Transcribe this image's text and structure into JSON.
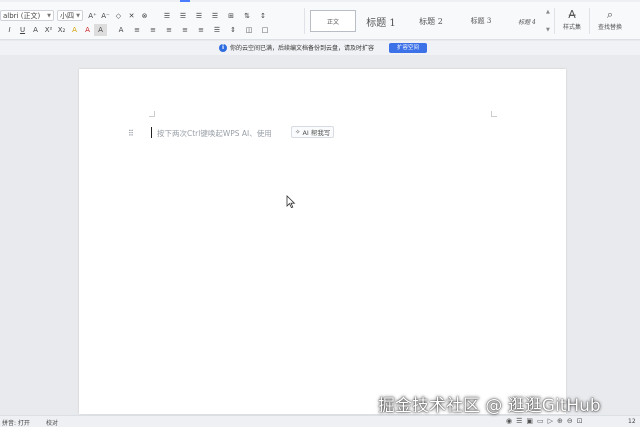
{
  "ribbon": {
    "font_name": "albri (正文)",
    "font_size": "小四",
    "row1": [
      "A⁺",
      "A⁻",
      "◇",
      "✕",
      "⊗"
    ],
    "row1b": [
      "☰",
      "☰",
      "☰",
      "☰",
      "⊞",
      "⇅",
      "↕"
    ],
    "row2": [
      "I",
      "U",
      "A",
      "X²",
      "X₂",
      "A",
      "A",
      "A"
    ],
    "row2b": [
      "A",
      "≡",
      "≡",
      "≡",
      "≡",
      "≡",
      "☰",
      "⇕",
      "◫",
      "□"
    ],
    "styles": {
      "normal": "正文",
      "h1": "标题 1",
      "h2": "标题 2",
      "h3": "标题 3",
      "h4": "标题 4"
    },
    "style_set_label": "样式集",
    "find_replace_label": "查找替换"
  },
  "notice": {
    "text": "你的云空间已满，后续编文档备份到云盘，请及时扩容",
    "button": "扩容空间"
  },
  "editor": {
    "hint": "按下两次Ctrl键唤起WPS AI、使用",
    "ai_chip": "AI 帮我写"
  },
  "status": {
    "left": "拼音: 打开",
    "proof": "校对",
    "zoom": "12"
  },
  "watermark": "掘金技术社区 @ 逛逛GitHub",
  "colors": {
    "accent": "#3c71e8",
    "ribbon_bg": "#f8f9fb",
    "canvas_bg": "#e9eaed"
  }
}
